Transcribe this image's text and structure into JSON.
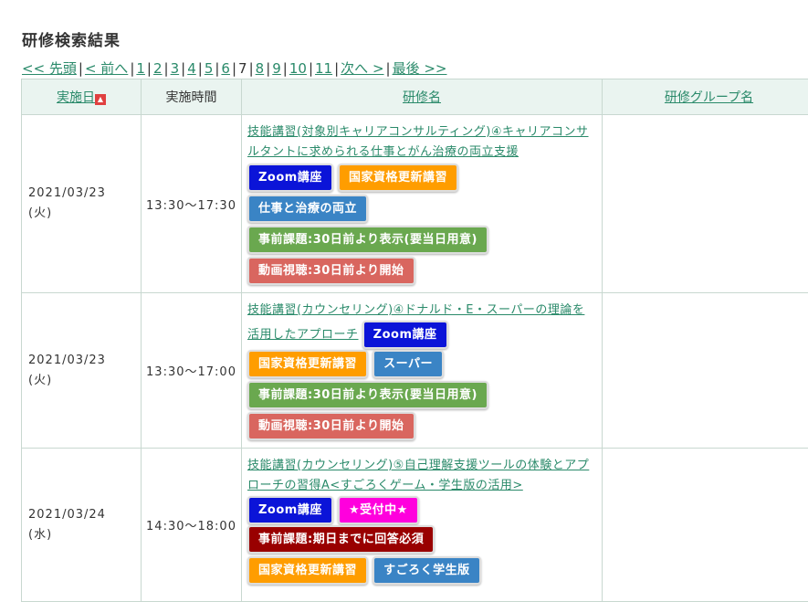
{
  "page": {
    "title": "研修検索結果"
  },
  "pager": {
    "first": "<< 先頭",
    "prev": "< 前へ",
    "pages": [
      "1",
      "2",
      "3",
      "4",
      "5",
      "6",
      "7",
      "8",
      "9",
      "10",
      "11"
    ],
    "current": "7",
    "next": "次へ >",
    "last": "最後 >>"
  },
  "table": {
    "headers": {
      "date": "実施日",
      "time": "実施時間",
      "name": "研修名",
      "group": "研修グループ名"
    },
    "sort_indicator": "▲",
    "rows": [
      {
        "date": "2021/03/23",
        "weekday": "(火)",
        "time": "13:30〜17:30",
        "title": "技能講習(対象別キャリアコンサルティング)④キャリアコンサルタントに求められる仕事とがん治療の両立支援",
        "group": "",
        "badges": [
          {
            "label": "Zoom講座",
            "color": "#0b14d8"
          },
          {
            "label": "国家資格更新講習",
            "color": "#ff9d00"
          },
          {
            "label": "仕事と治療の両立",
            "color": "#3a84c5"
          },
          {
            "label": "事前課題:30日前より表示(要当日用意)",
            "color": "#6aa84f"
          },
          {
            "label": "動画視聴:30日前より開始",
            "color": "#d9665f"
          }
        ]
      },
      {
        "date": "2021/03/23",
        "weekday": "(火)",
        "time": "13:30〜17:00",
        "title": "技能講習(カウンセリング)④ドナルド・E・スーパーの理論を活用したアプローチ",
        "group": "",
        "badges": [
          {
            "label": "Zoom講座",
            "color": "#0b14d8"
          },
          {
            "label": "国家資格更新講習",
            "color": "#ff9d00"
          },
          {
            "label": "スーパー",
            "color": "#3a84c5"
          },
          {
            "label": "事前課題:30日前より表示(要当日用意)",
            "color": "#6aa84f"
          },
          {
            "label": "動画視聴:30日前より開始",
            "color": "#d9665f"
          }
        ]
      },
      {
        "date": "2021/03/24",
        "weekday": "(水)",
        "time": "14:30〜18:00",
        "title": "技能講習(カウンセリング)⑤自己理解支援ツールの体験とアプローチの習得A<すごろくゲーム・学生版の活用>",
        "group": "",
        "badges": [
          {
            "label": "Zoom講座",
            "color": "#0b14d8"
          },
          {
            "label": "★受付中★",
            "color": "#ff00dd"
          },
          {
            "label": "事前課題:期日までに回答必須",
            "color": "#990000"
          },
          {
            "label": "国家資格更新講習",
            "color": "#ff9d00"
          },
          {
            "label": "すごろく学生版",
            "color": "#3a84c5"
          }
        ]
      }
    ]
  }
}
